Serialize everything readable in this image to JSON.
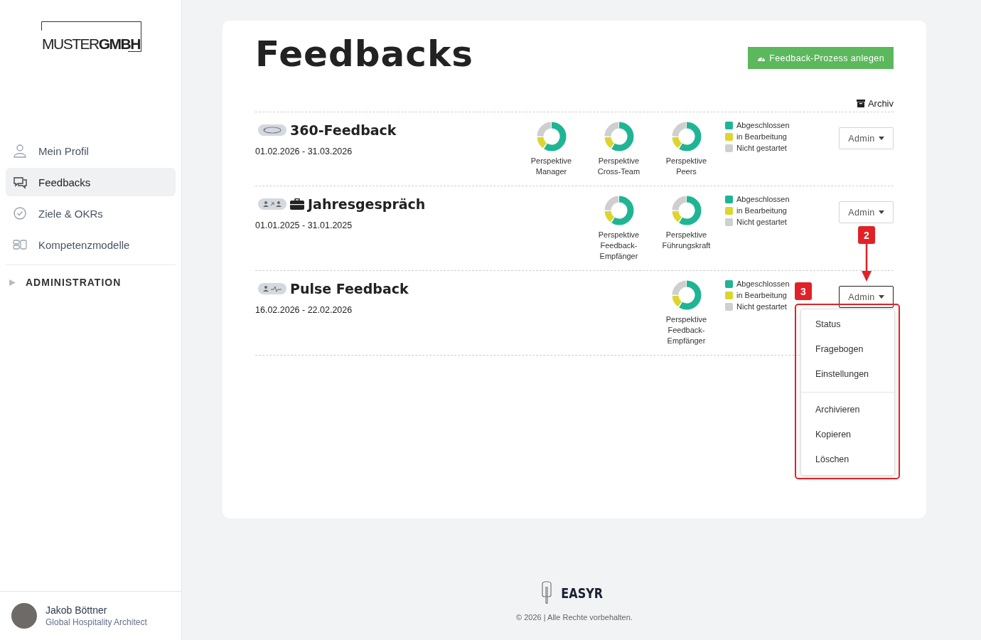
{
  "sidebar": {
    "logo": {
      "light": "MUSTER",
      "bold": "GMBH"
    },
    "nav": [
      {
        "label": "Mein Profil",
        "selected": false
      },
      {
        "label": "Feedbacks",
        "selected": true
      },
      {
        "label": "Ziele & OKRs",
        "selected": false
      },
      {
        "label": "Kompetenzmodelle",
        "selected": false
      }
    ],
    "sections": [
      {
        "label": "ADMINISTRATION",
        "expanded": false
      }
    ],
    "user": {
      "name": "Jakob Böttner",
      "role": "Global Hospitality Architect"
    }
  },
  "page": {
    "title": "Feedbacks",
    "create_button": "Feedback-Prozess anlegen",
    "archive_link": "Archiv"
  },
  "processes": [
    {
      "kind": "rotation",
      "title": "360-Feedback",
      "dates": "01.02.2026 - 31.03.2026",
      "perspectives": [
        {
          "label": "Perspektive Manager"
        },
        {
          "label": "Perspektive Cross-Team"
        },
        {
          "label": "Perspektive Peers"
        }
      ],
      "legend": [
        {
          "label": "Abgeschlossen",
          "color": "#1fb594"
        },
        {
          "label": "in Bearbeitung",
          "color": "#dcd52f"
        },
        {
          "label": "Nicht gestartet",
          "color": "#cfcfcf"
        }
      ],
      "admin_button": "Admin",
      "menu_open": false
    },
    {
      "kind": "annual",
      "title": "Jahresgespräch",
      "dates": "01.01.2025 - 31.01.2025",
      "perspectives": [
        {
          "label": "Perspektive Feedback-Empfänger"
        },
        {
          "label": "Perspektive Führungskraft"
        }
      ],
      "legend": [
        {
          "label": "Abgeschlossen",
          "color": "#1fb594"
        },
        {
          "label": "in Bearbeitung",
          "color": "#dcd52f"
        },
        {
          "label": "Nicht gestartet",
          "color": "#cfcfcf"
        }
      ],
      "admin_button": "Admin",
      "menu_open": false,
      "callout": {
        "label": "2",
        "kind": "arrow"
      }
    },
    {
      "kind": "pulse",
      "title": "Pulse Feedback",
      "dates": "16.02.2026 - 22.02.2026",
      "perspectives": [
        {
          "label": "Perspektive Feedback-Empfänger"
        }
      ],
      "legend": [
        {
          "label": "Abgeschlossen",
          "color": "#1fb594"
        },
        {
          "label": "in Bearbeitung",
          "color": "#dcd52f"
        },
        {
          "label": "Nicht gestartet",
          "color": "#cfcfcf"
        }
      ],
      "admin_button": "Admin",
      "menu_open": true,
      "callout": {
        "label": "3",
        "kind": "outline"
      }
    }
  ],
  "dropdown": {
    "groups": [
      [
        "Status",
        "Fragebogen",
        "Einstellungen"
      ],
      [
        "Archivieren",
        "Kopieren",
        "Löschen"
      ]
    ]
  },
  "footer": {
    "brand": "EASYR",
    "copyright": "© 2026 | Alle Rechte vorbehalten."
  }
}
